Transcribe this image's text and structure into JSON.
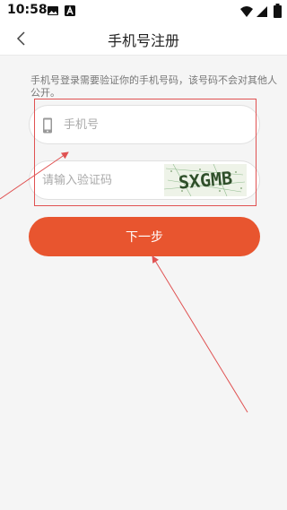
{
  "status_bar": {
    "time": "10:58",
    "icons": [
      "photo-icon",
      "a-icon",
      "wifi-icon",
      "signal-icon",
      "battery-icon"
    ]
  },
  "app_bar": {
    "back_icon": "chevron-left-icon",
    "title": "手机号注册"
  },
  "form": {
    "hint": "手机号登录需要验证你的手机号码，该号码不会对其他人公开。",
    "phone_placeholder": "手机号",
    "phone_value": "",
    "phone_icon": "phone-icon",
    "code_placeholder": "请输入验证码",
    "code_value": "",
    "captcha_text": "SXGMB"
  },
  "next_button": {
    "label": "下一步"
  },
  "colors": {
    "accent": "#e8552f",
    "annotation": "#e05252",
    "background": "#f5f5f5"
  }
}
